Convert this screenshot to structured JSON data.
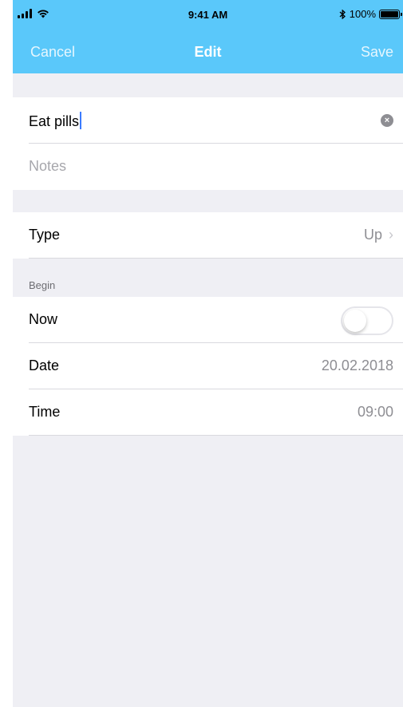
{
  "status_bar": {
    "time": "9:41 AM",
    "battery": "100%"
  },
  "nav": {
    "cancel_label": "Cancel",
    "title": "Edit",
    "save_label": "Save"
  },
  "form": {
    "title_value": "Eat pills",
    "notes_placeholder": "Notes"
  },
  "type": {
    "label": "Type",
    "value": "Up"
  },
  "begin": {
    "section_title": "Begin",
    "now_label": "Now",
    "now_enabled": false,
    "date_label": "Date",
    "date_value": "20.02.2018",
    "time_label": "Time",
    "time_value": "09:00"
  },
  "colors": {
    "nav_bar": "#5ac8fa",
    "background": "#efeff4"
  }
}
